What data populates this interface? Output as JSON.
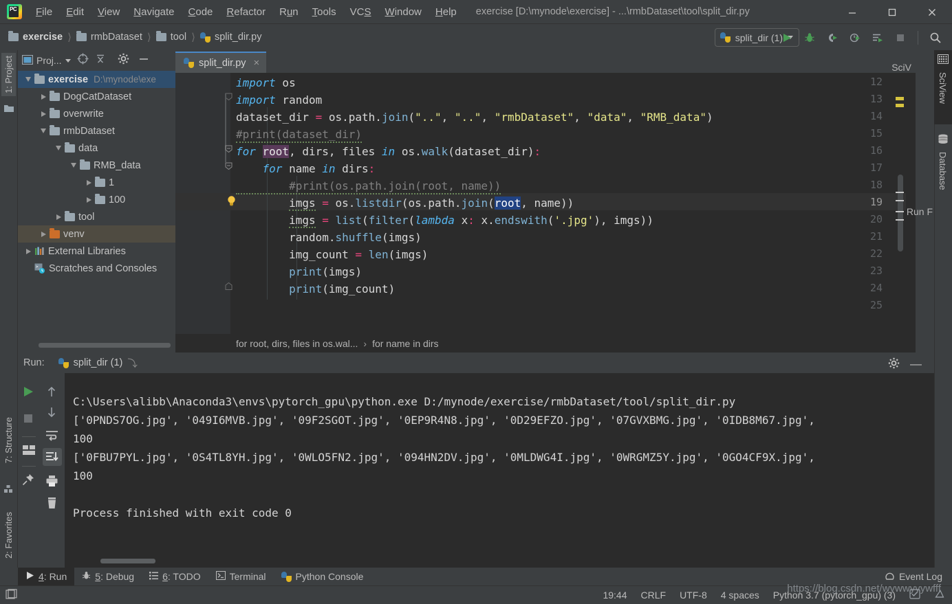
{
  "window": {
    "title": "exercise [D:\\mynode\\exercise] - ...\\rmbDataset\\tool\\split_dir.py",
    "logo_text": "PC",
    "minimize": "minimize-button",
    "maximize": "maximize-button",
    "close": "close-button"
  },
  "menubar": {
    "items": [
      {
        "label": "File",
        "mnemonic": "F"
      },
      {
        "label": "Edit",
        "mnemonic": "E"
      },
      {
        "label": "View",
        "mnemonic": "V"
      },
      {
        "label": "Navigate",
        "mnemonic": "N"
      },
      {
        "label": "Code",
        "mnemonic": "C"
      },
      {
        "label": "Refactor",
        "mnemonic": "R"
      },
      {
        "label": "Run",
        "mnemonic": "u"
      },
      {
        "label": "Tools",
        "mnemonic": "T"
      },
      {
        "label": "VCS",
        "mnemonic": "S"
      },
      {
        "label": "Window",
        "mnemonic": "W"
      },
      {
        "label": "Help",
        "mnemonic": "H"
      }
    ]
  },
  "breadcrumbs": {
    "items": [
      "exercise",
      "rmbDataset",
      "tool",
      "split_dir.py"
    ],
    "separator": "〉"
  },
  "toolbar": {
    "run_config": "split_dir (1)",
    "icons": [
      "run-icon",
      "debug-icon",
      "run-coverage-icon",
      "profile-icon",
      "run-with-console-icon",
      "stop-icon",
      "search-everywhere-icon"
    ]
  },
  "left_strip": {
    "project_tab": "1: Project",
    "structure_tab": "7: Structure",
    "favorites_tab": "2: Favorites"
  },
  "right_strip": {
    "sciview_tab": "SciView",
    "database_tab": "Database"
  },
  "project_panel": {
    "title": "Proj...",
    "header_icons": [
      "locate-icon",
      "collapse-all-icon",
      "settings-gear-icon",
      "hide-icon"
    ],
    "tree": [
      {
        "label": "exercise",
        "path": "D:\\mynode\\exe",
        "depth": 0,
        "state": "expanded",
        "icon": "folder-icon",
        "selected": "blue",
        "bold": true
      },
      {
        "label": "DogCatDataset",
        "path": "",
        "depth": 1,
        "state": "collapsed",
        "icon": "folder-icon",
        "selected": "",
        "bold": false
      },
      {
        "label": "overwrite",
        "path": "",
        "depth": 1,
        "state": "collapsed",
        "icon": "folder-icon",
        "selected": "",
        "bold": false
      },
      {
        "label": "rmbDataset",
        "path": "",
        "depth": 1,
        "state": "expanded",
        "icon": "folder-icon",
        "selected": "",
        "bold": false
      },
      {
        "label": "data",
        "path": "",
        "depth": 2,
        "state": "expanded",
        "icon": "folder-icon",
        "selected": "",
        "bold": false
      },
      {
        "label": "RMB_data",
        "path": "",
        "depth": 3,
        "state": "expanded",
        "icon": "folder-icon",
        "selected": "",
        "bold": false
      },
      {
        "label": "1",
        "path": "",
        "depth": 4,
        "state": "collapsed",
        "icon": "folder-icon",
        "selected": "",
        "bold": false
      },
      {
        "label": "100",
        "path": "",
        "depth": 4,
        "state": "collapsed",
        "icon": "folder-icon",
        "selected": "",
        "bold": false
      },
      {
        "label": "tool",
        "path": "",
        "depth": 2,
        "state": "collapsed",
        "icon": "folder-icon",
        "selected": "",
        "bold": false
      },
      {
        "label": "venv",
        "path": "",
        "depth": 1,
        "state": "collapsed",
        "icon": "folder-icon-orange",
        "selected": "brown",
        "bold": false
      },
      {
        "label": "External Libraries",
        "path": "",
        "depth": 0,
        "state": "collapsed",
        "icon": "libraries-icon",
        "selected": "",
        "bold": false
      },
      {
        "label": "Scratches and Consoles",
        "path": "",
        "depth": 0,
        "state": "none",
        "icon": "scratches-icon",
        "selected": "",
        "bold": false
      }
    ]
  },
  "editor": {
    "tab_label": "split_dir.py",
    "tab_close": "×",
    "sciview_label": "SciV",
    "breadcrumb_left": "for root, dirs, files in os.wal...",
    "breadcrumb_sep": "›",
    "breadcrumb_right": "for name in dirs",
    "first_line_number": 12,
    "highlighted_line": 19,
    "lines": [
      {
        "n": 12,
        "code": "import os"
      },
      {
        "n": 13,
        "code": "import random"
      },
      {
        "n": 14,
        "code": "dataset_dir = os.path.join(\"..\", \"..\", \"rmbDataset\", \"data\", \"RMB_data\")"
      },
      {
        "n": 15,
        "code": "#print(dataset_dir)"
      },
      {
        "n": 16,
        "code": "for root, dirs, files in os.walk(dataset_dir):"
      },
      {
        "n": 17,
        "code": "    for name in dirs:"
      },
      {
        "n": 18,
        "code": "        #print(os.path.join(root, name))"
      },
      {
        "n": 19,
        "code": "        imgs = os.listdir(os.path.join(root, name))"
      },
      {
        "n": 20,
        "code": "        imgs = list(filter(lambda x: x.endswith('.jpg'), imgs))"
      },
      {
        "n": 21,
        "code": "        random.shuffle(imgs)"
      },
      {
        "n": 22,
        "code": "        img_count = len(imgs)"
      },
      {
        "n": 23,
        "code": "        print(imgs)"
      },
      {
        "n": 24,
        "code": "        print(img_count)"
      },
      {
        "n": 25,
        "code": ""
      }
    ]
  },
  "run_panel": {
    "label": "Run:",
    "tab": "split_dir (1)",
    "gear": "settings-gear-icon",
    "minimize": "—",
    "side_label": "Run F",
    "toolbar_icons": [
      "rerun-icon",
      "stop-icon",
      "layout-icon",
      "pin-icon"
    ],
    "toolbar2_icons": [
      "up-icon",
      "down-icon",
      "soft-wrap-icon",
      "scroll-to-end-icon",
      "print-icon",
      "clear-all-icon"
    ],
    "console": [
      "C:\\Users\\alibb\\Anaconda3\\envs\\pytorch_gpu\\python.exe D:/mynode/exercise/rmbDataset/tool/split_dir.py",
      "['0PNDS7OG.jpg', '049I6MVB.jpg', '09F2SGOT.jpg', '0EP9R4N8.jpg', '0D29EFZO.jpg', '07GVXBMG.jpg', '0IDB8M67.jpg',",
      "100",
      "['0FBU7PYL.jpg', '0S4TL8YH.jpg', '0WLO5FN2.jpg', '094HN2DV.jpg', '0MLDWG4I.jpg', '0WRGMZ5Y.jpg', '0GO4CF9X.jpg',",
      "100",
      "",
      "Process finished with exit code 0"
    ]
  },
  "bottom_bar": {
    "items": [
      {
        "label": "4: Run",
        "mnemonic": "4",
        "icon": "run-icon",
        "selected": true
      },
      {
        "label": "5: Debug",
        "mnemonic": "5",
        "icon": "debug-icon",
        "selected": false
      },
      {
        "label": "6: TODO",
        "mnemonic": "6",
        "icon": "todo-icon",
        "selected": false
      },
      {
        "label": "Terminal",
        "mnemonic": "",
        "icon": "terminal-icon",
        "selected": false
      },
      {
        "label": "Python Console",
        "mnemonic": "",
        "icon": "python-icon",
        "selected": false
      }
    ],
    "event_log": "Event Log"
  },
  "status_bar": {
    "position": "19:44",
    "line_sep": "CRLF",
    "encoding": "UTF-8",
    "indent": "4 spaces",
    "interpreter": "Python 3.7 (pytorch_gpu) (3)",
    "watermark": "https://blog.csdn.net/wywwyyywfff"
  },
  "colors": {
    "panel_bg": "#3c3f41",
    "editor_bg": "#2b2b2b",
    "gutter_bg": "#313335",
    "accent_blue": "#4a88c7",
    "keyword_orange": "#cc7832",
    "string_green": "#6a8759",
    "number_blue": "#6897bb",
    "comment_gray": "#808080",
    "selection_blue": "#214283",
    "run_green": "#4a9e4a"
  }
}
